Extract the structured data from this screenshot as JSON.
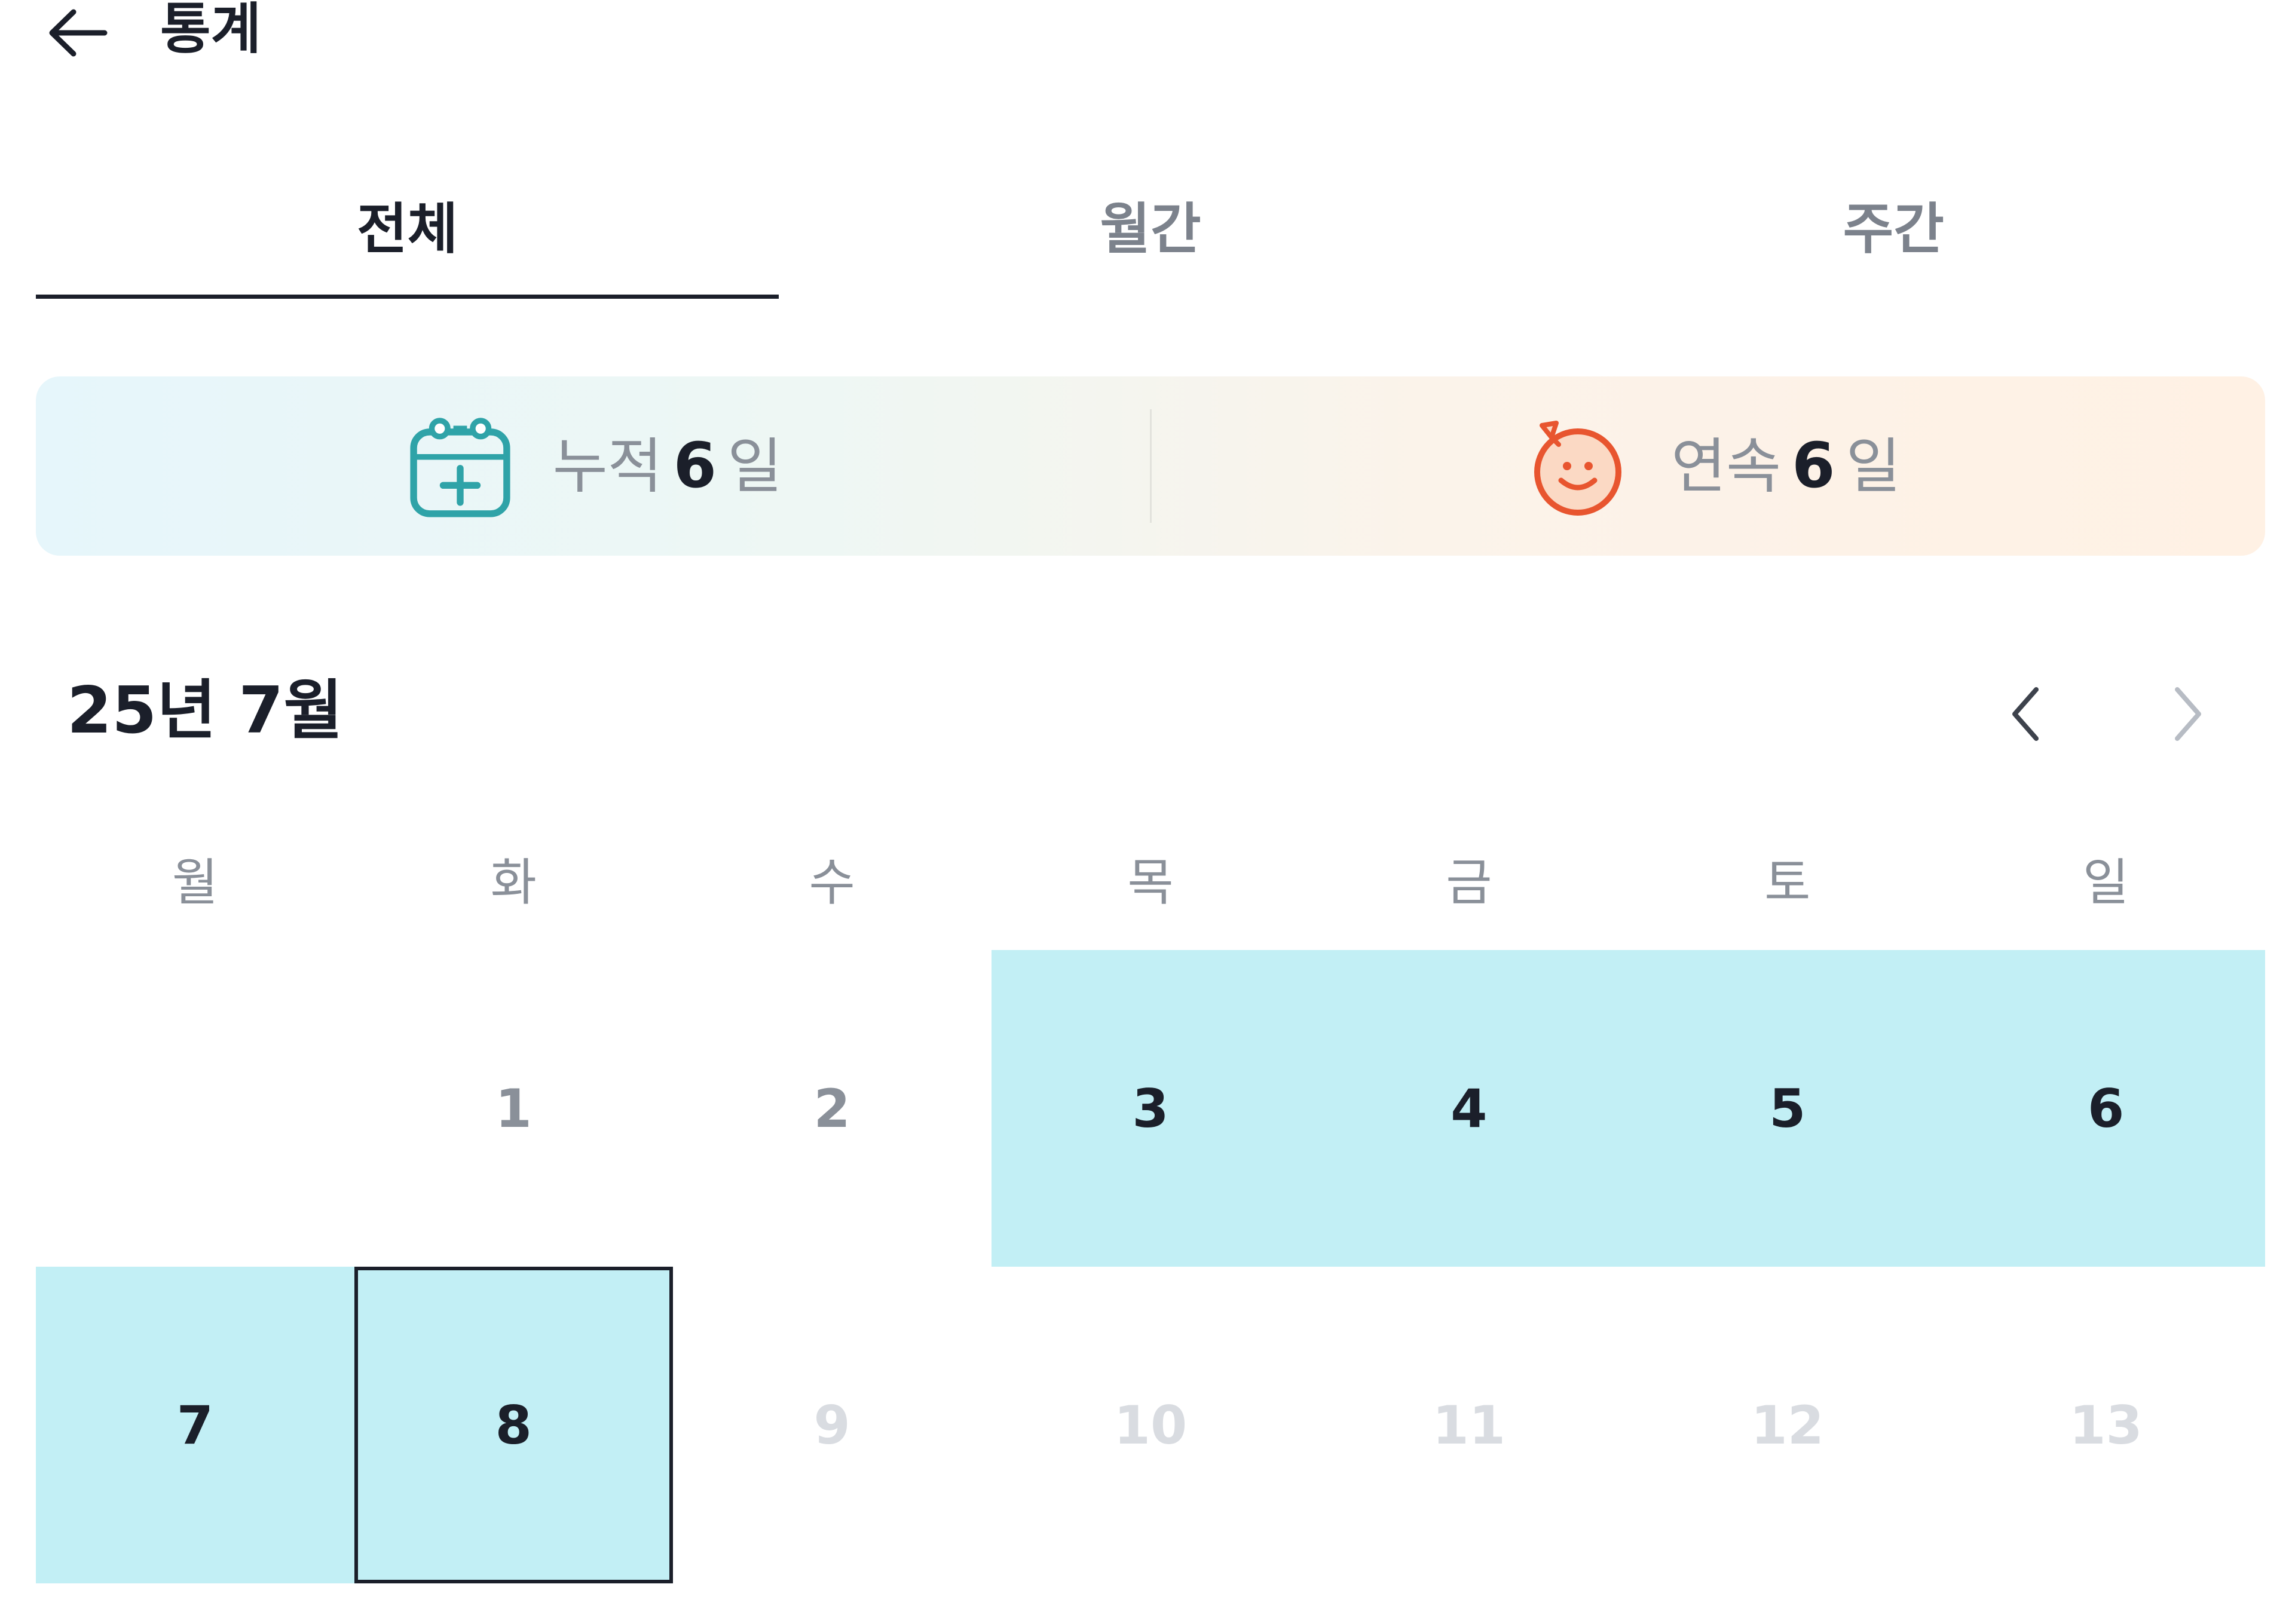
{
  "header": {
    "title": "통계",
    "back_icon": "arrow-left-icon"
  },
  "tabs": [
    {
      "label": "전체",
      "active": true
    },
    {
      "label": "월간",
      "active": false
    },
    {
      "label": "주간",
      "active": false
    }
  ],
  "stats": {
    "cumulative": {
      "label": "누적",
      "value": "6",
      "unit": "일",
      "icon": "calendar-plus-icon",
      "color": "#2fa3a8"
    },
    "streak": {
      "label": "연속",
      "value": "6",
      "unit": "일",
      "icon": "smiley-face-icon",
      "color": "#e8552f"
    }
  },
  "calendar": {
    "month_label": "25년 7월",
    "prev_icon": "chevron-left-icon",
    "next_icon": "chevron-right-icon",
    "weekdays": [
      "월",
      "화",
      "수",
      "목",
      "금",
      "토",
      "일"
    ],
    "highlight_color": "#c2eff5",
    "days": [
      {
        "label": "",
        "state": "empty"
      },
      {
        "label": "1",
        "state": "past"
      },
      {
        "label": "2",
        "state": "past"
      },
      {
        "label": "3",
        "state": "checked"
      },
      {
        "label": "4",
        "state": "checked"
      },
      {
        "label": "5",
        "state": "checked"
      },
      {
        "label": "6",
        "state": "checked"
      },
      {
        "label": "7",
        "state": "checked"
      },
      {
        "label": "8",
        "state": "today"
      },
      {
        "label": "9",
        "state": "future"
      },
      {
        "label": "10",
        "state": "future"
      },
      {
        "label": "11",
        "state": "future"
      },
      {
        "label": "12",
        "state": "future"
      },
      {
        "label": "13",
        "state": "future"
      }
    ]
  }
}
